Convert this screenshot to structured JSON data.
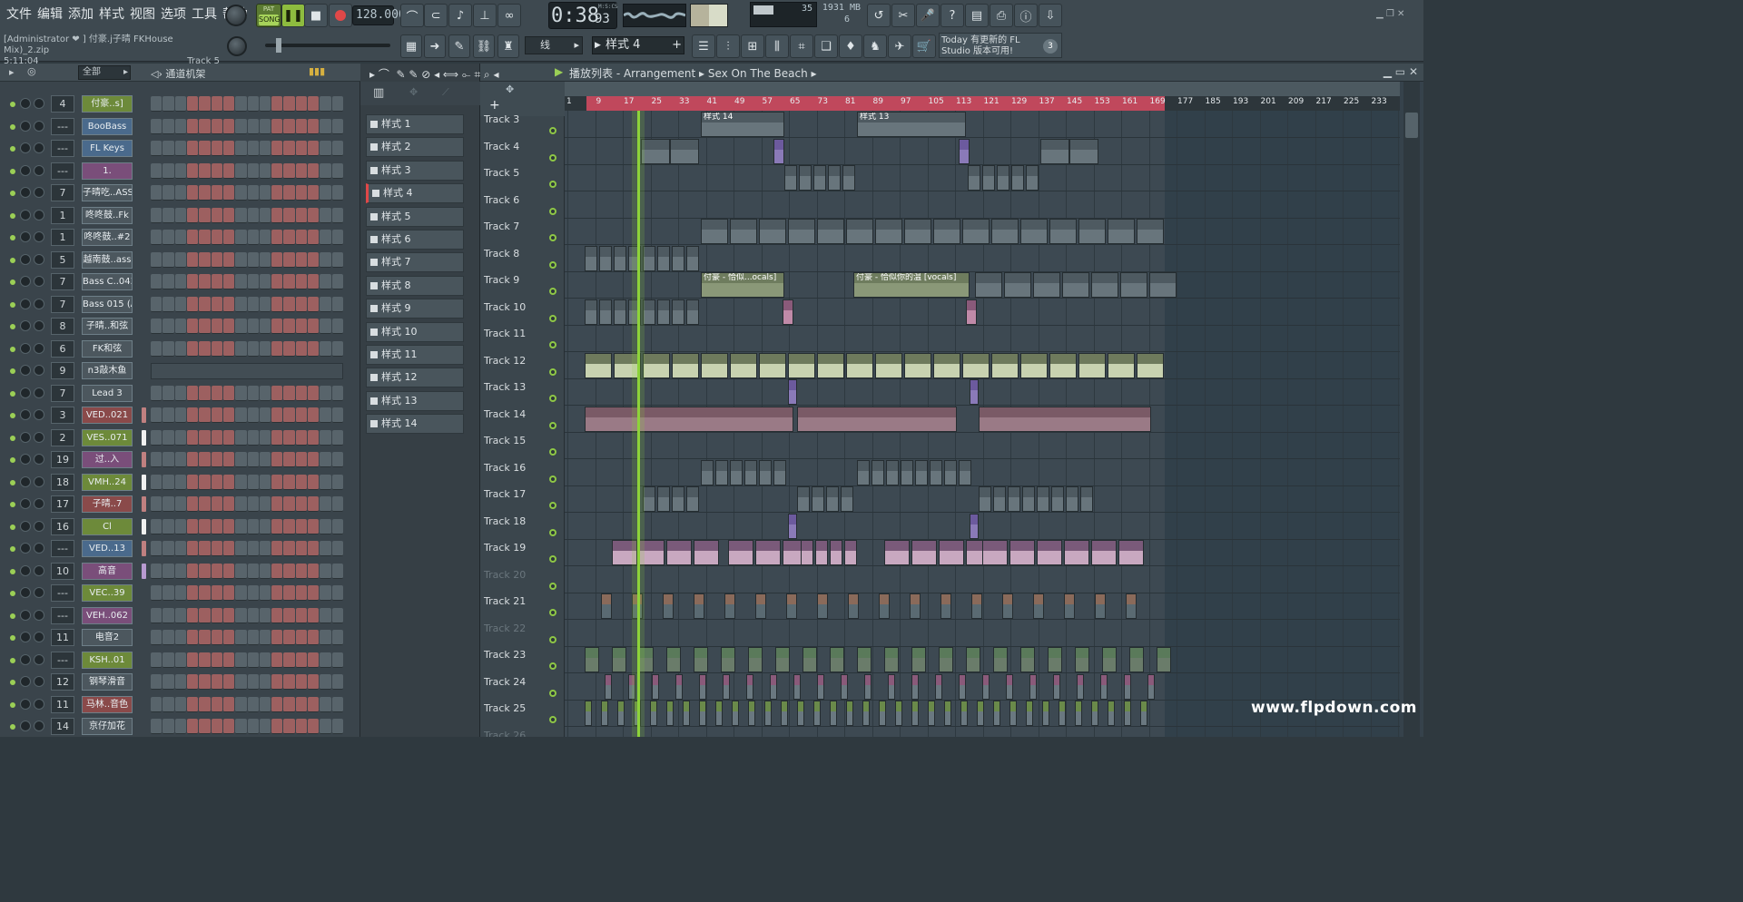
{
  "menu": [
    "文件",
    "编辑",
    "添加",
    "样式",
    "视图",
    "选项",
    "工具",
    "帮助"
  ],
  "transport": {
    "mode_pat": "PAT",
    "mode_song": "SONG",
    "tempo": "128.000",
    "time": "0:38",
    "time_frac": "93",
    "time_unit": "M:S:CS"
  },
  "monitor": {
    "cpu": "35",
    "mem": "1931 MB",
    "voices": "6"
  },
  "hint": {
    "title": "[Administrator ❤",
    "file": "] 付豪.j子晴 FKHouse Mix)_2.zip",
    "pos": "5:11:04",
    "track": "Track 5"
  },
  "tools": {
    "snap": "线",
    "pattern_sel": "样式 4"
  },
  "news": {
    "line1": "Today  有更新的 FL",
    "line2": "Studio 版本可用!",
    "badge": "3"
  },
  "rack": {
    "filter": "全部",
    "title": "通道机架",
    "channels": [
      {
        "num": "4",
        "name": "付豪..s]",
        "color": "#6d8a3a",
        "sel": ""
      },
      {
        "num": "---",
        "name": "BooBass",
        "color": "#4a6a8c",
        "sel": ""
      },
      {
        "num": "---",
        "name": "FL Keys",
        "color": "#4a6a8c",
        "sel": ""
      },
      {
        "num": "---",
        "name": "1.",
        "color": "#7a4e7a",
        "sel": ""
      },
      {
        "num": "7",
        "name": "子晴吃..ASS",
        "color": "#4c575e",
        "sel": ""
      },
      {
        "num": "1",
        "name": "咚咚鼓..Fk",
        "color": "#4c575e",
        "sel": ""
      },
      {
        "num": "1",
        "name": "咚咚鼓..#2",
        "color": "#4c575e",
        "sel": ""
      },
      {
        "num": "5",
        "name": "越南鼓..ass",
        "color": "#4c575e",
        "sel": ""
      },
      {
        "num": "7",
        "name": "Bass C..043 C",
        "color": "#4c575e",
        "sel": ""
      },
      {
        "num": "7",
        "name": "Bass 015 (A)",
        "color": "#4c575e",
        "sel": ""
      },
      {
        "num": "8",
        "name": "子晴..和弦",
        "color": "#4c575e",
        "sel": ""
      },
      {
        "num": "6",
        "name": "FK和弦",
        "color": "#4c575e",
        "sel": ""
      },
      {
        "num": "9",
        "name": "n3敲木鱼",
        "color": "#4c575e",
        "sel": ""
      },
      {
        "num": "7",
        "name": "Lead 3",
        "color": "#4c575e",
        "sel": ""
      },
      {
        "num": "3",
        "name": "VED..021",
        "color": "#8a4a4a",
        "sel": "#c08080"
      },
      {
        "num": "2",
        "name": "VES..071",
        "color": "#6d8a3a",
        "sel": "#f0f0f0"
      },
      {
        "num": "19",
        "name": "过..入",
        "color": "#7a4e7a",
        "sel": "#c08080"
      },
      {
        "num": "18",
        "name": "VMH..24",
        "color": "#6d8a3a",
        "sel": "#f0f0f0"
      },
      {
        "num": "17",
        "name": "子晴..7",
        "color": "#8a4a4a",
        "sel": "#c08080"
      },
      {
        "num": "16",
        "name": "Cl",
        "color": "#6d8a3a",
        "sel": "#f0f0f0"
      },
      {
        "num": "---",
        "name": "VED..13",
        "color": "#4a6a8c",
        "sel": "#c08080"
      },
      {
        "num": "10",
        "name": "高音",
        "color": "#7a4e7a",
        "sel": "#b89ad0"
      },
      {
        "num": "---",
        "name": "VEC..39",
        "color": "#6d8a3a",
        "sel": ""
      },
      {
        "num": "---",
        "name": "VEH..062",
        "color": "#7a4e7a",
        "sel": ""
      },
      {
        "num": "11",
        "name": "电音2",
        "color": "#4c575e",
        "sel": ""
      },
      {
        "num": "---",
        "name": "KSH..01",
        "color": "#6d8a3a",
        "sel": ""
      },
      {
        "num": "12",
        "name": "钢琴滑音",
        "color": "#4c575e",
        "sel": ""
      },
      {
        "num": "11",
        "name": "马林..音色",
        "color": "#8a4a4a",
        "sel": ""
      },
      {
        "num": "14",
        "name": "京仔加花",
        "color": "#4c575e",
        "sel": ""
      }
    ]
  },
  "patterns": [
    "样式 1",
    "样式 2",
    "样式 3",
    "样式 4",
    "样式 5",
    "样式 6",
    "样式 7",
    "样式 8",
    "样式 9",
    "样式 10",
    "样式 11",
    "样式 12",
    "样式 13",
    "样式 14"
  ],
  "playlist": {
    "title": "播放列表 - Arrangement",
    "song": "Sex On The Beach",
    "ruler": [
      "1",
      "9",
      "17",
      "25",
      "33",
      "41",
      "49",
      "57",
      "65",
      "73",
      "81",
      "89",
      "97",
      "105",
      "113",
      "121",
      "129",
      "137",
      "145",
      "153",
      "161",
      "169",
      "177",
      "185",
      "193",
      "201",
      "209",
      "217",
      "225",
      "233"
    ],
    "tracks": [
      "Track 3",
      "Track 4",
      "Track 5",
      "Track 6",
      "Track 7",
      "Track 8",
      "Track 9",
      "Track 10",
      "Track 11",
      "Track 12",
      "Track 13",
      "Track 14",
      "Track 15",
      "Track 16",
      "Track 17",
      "Track 18",
      "Track 19",
      "Track 20",
      "Track 21",
      "Track 22",
      "Track 23",
      "Track 24",
      "Track 25",
      "Track 26"
    ],
    "muted": [
      "Track 20",
      "Track 22",
      "Track 26"
    ],
    "clip_labels": {
      "pattern14": "样式 14",
      "pattern13": "样式 13",
      "vocal1": "付豪 - 恰似...ocals]",
      "vocal2": "付豪 - 恰似你的温 [vocals]"
    }
  },
  "watermark": "www.flpdown.com"
}
